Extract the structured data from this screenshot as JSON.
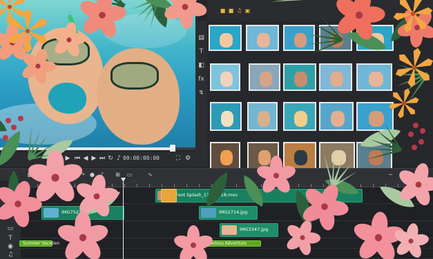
{
  "preview": {
    "timecode": "00:00:00:00"
  },
  "library": {
    "toolbar_icons": [
      "folder-icon",
      "folder-icon",
      "audio-icon",
      "video-icon"
    ],
    "sidebar_icons": [
      "media-icon",
      "title-icon",
      "transition-icon",
      "fx-icon",
      "path-icon"
    ],
    "thumb_colors": [
      [
        "#2aa6c9",
        "#f2c8a0"
      ],
      [
        "#6fb7d6",
        "#e7b59a"
      ],
      [
        "#3aa1cc",
        "#d59c7c"
      ],
      [
        "#5a7f8f",
        "#c07b56"
      ],
      [
        "#7cc4de",
        "#f1d2bb"
      ],
      [
        "#8aa7b9",
        "#d8a487"
      ],
      [
        "#2fa0a8",
        "#c68e6d"
      ],
      [
        "#7fb8d8",
        "#e0ad8d"
      ],
      [
        "#2e9bb6",
        "#f0e0c0"
      ],
      [
        "#73b6d2",
        "#d9b08e"
      ],
      [
        "#3aa7b8",
        "#f1ce8a"
      ],
      [
        "#56a6cb",
        "#e2b090"
      ],
      [
        "#5f4d3f",
        "#f0a050"
      ],
      [
        "#6b5a48",
        "#e0a070"
      ],
      [
        "#ba7d42",
        "#2c3a44"
      ],
      [
        "#8c7b62",
        "#e1cfa8"
      ]
    ]
  },
  "timeline": {
    "clips": {
      "foot_splash": "Foot Splash_11778618.mov",
      "img_a": "IMG7522.jpg",
      "img_b": "IMG2714.jpg",
      "img_c": "IMG3347.jpg",
      "summer": "Summer Vacation",
      "adventure": "Marvelous Adventure"
    }
  }
}
